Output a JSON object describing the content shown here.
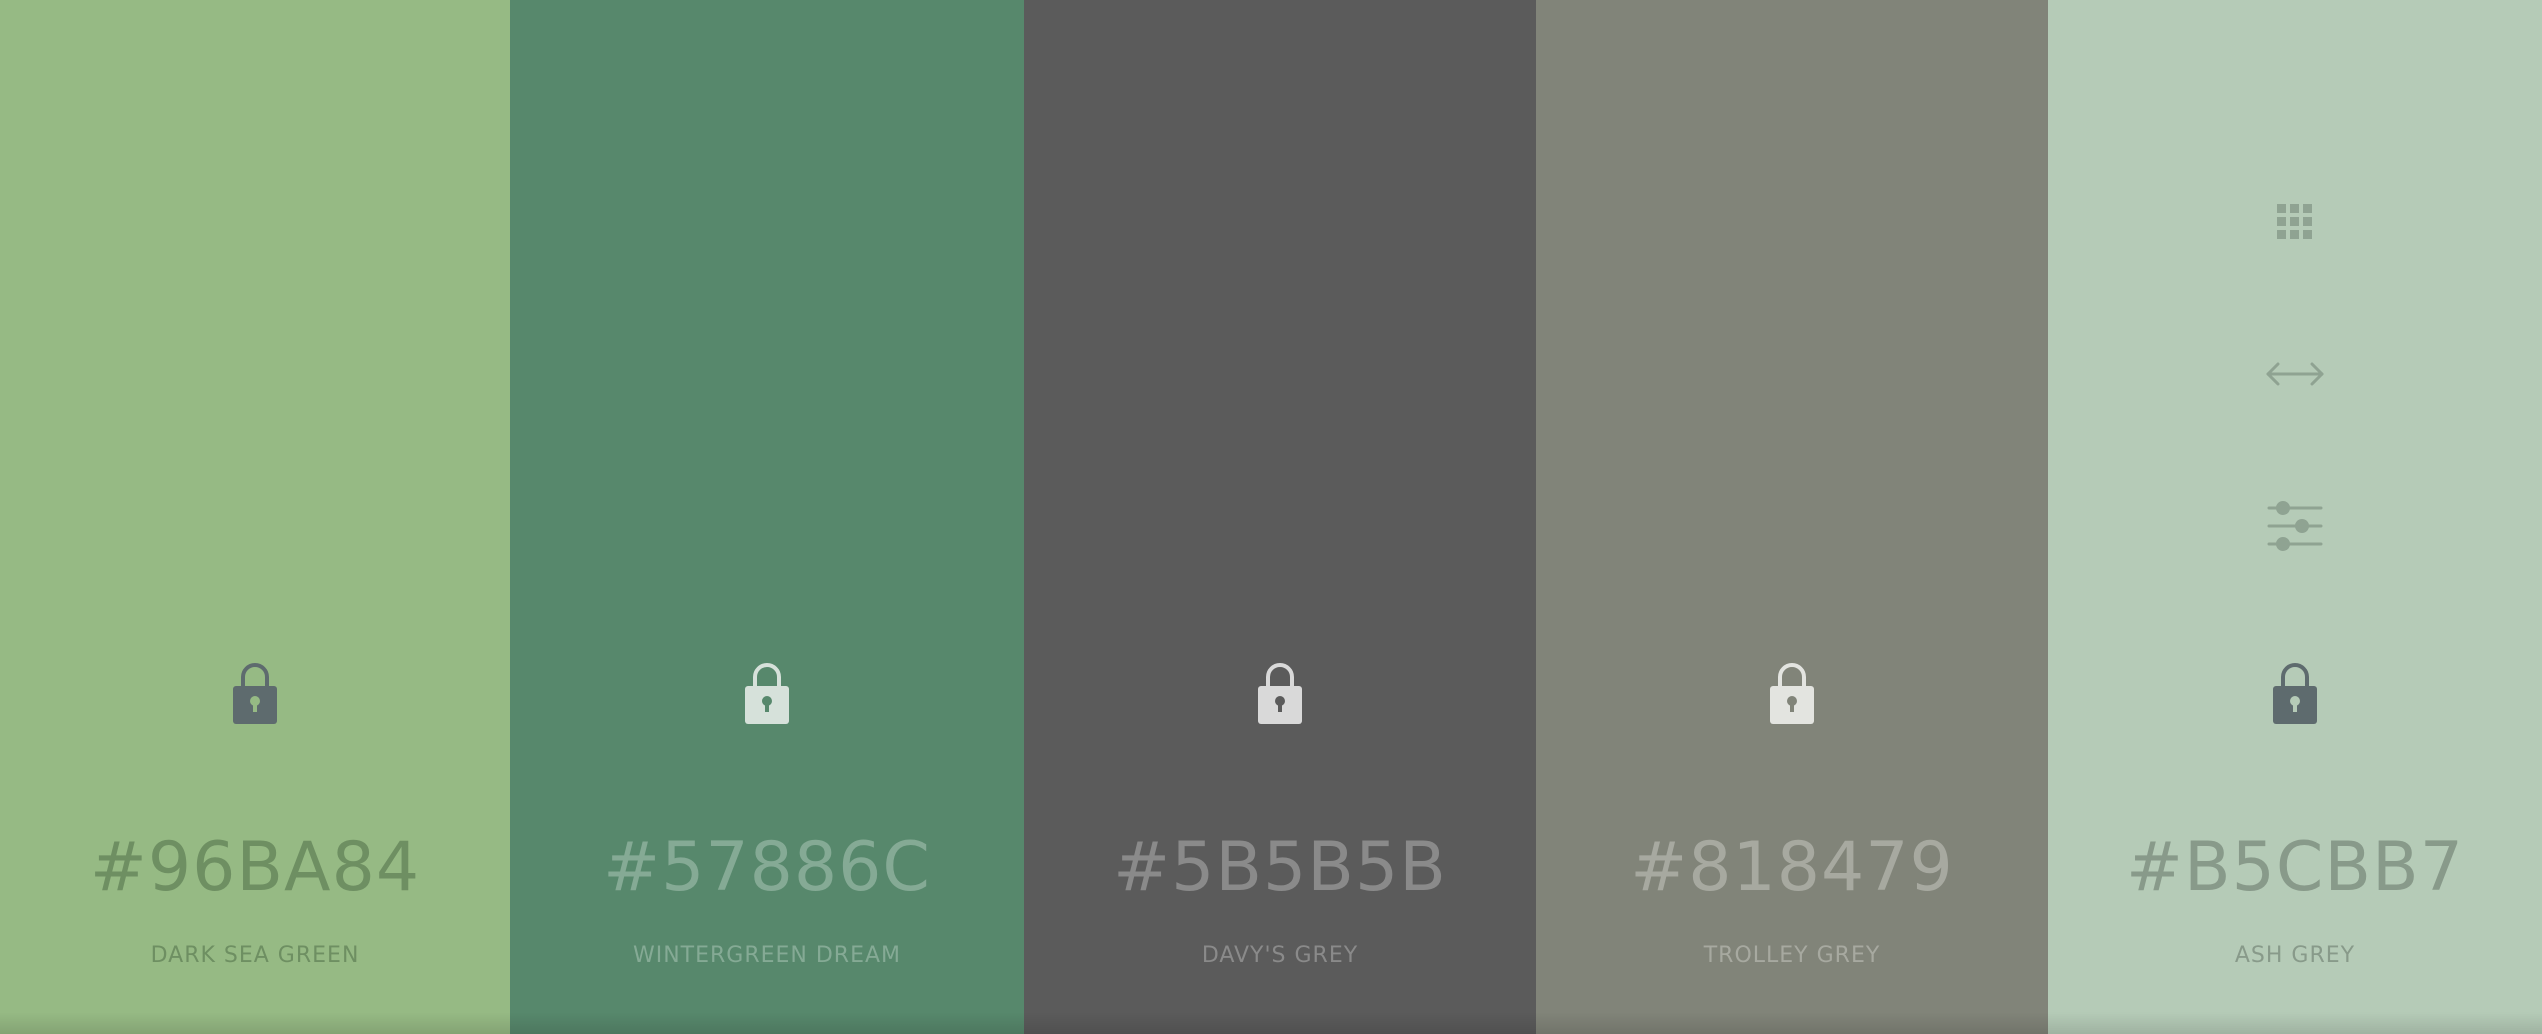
{
  "swatches": [
    {
      "hex": "#96BA84",
      "name": "DARK SEA GREEN",
      "background_color": "#96BA84",
      "text_color": "#6E8F62",
      "lock_icon": "lock-icon",
      "lock_color": "#5E6B6E"
    },
    {
      "hex": "#57886C",
      "name": "WINTERGREEN DREAM",
      "background_color": "#57886C",
      "text_color": "#85AA95",
      "lock_icon": "lock-icon",
      "lock_color": "#D6E1DA"
    },
    {
      "hex": "#5B5B5B",
      "name": "DAVY'S GREY",
      "background_color": "#5B5B5B",
      "text_color": "#8A8A8A",
      "lock_icon": "lock-icon",
      "lock_color": "#D9D9D9"
    },
    {
      "hex": "#818479",
      "name": "TROLLEY GREY",
      "background_color": "#818479",
      "text_color": "#A7A9A0",
      "lock_icon": "lock-icon",
      "lock_color": "#E3E4E0"
    },
    {
      "hex": "#B5CBB7",
      "name": "ASH GREY",
      "background_color": "#B5CBB7",
      "text_color": "#889A8A",
      "lock_icon": "lock-icon",
      "lock_color": "#5E6B6E",
      "tool_icons": [
        "grid-icon",
        "arrows-horizontal-icon",
        "sliders-icon"
      ],
      "tool_color": "#8FA392"
    }
  ]
}
